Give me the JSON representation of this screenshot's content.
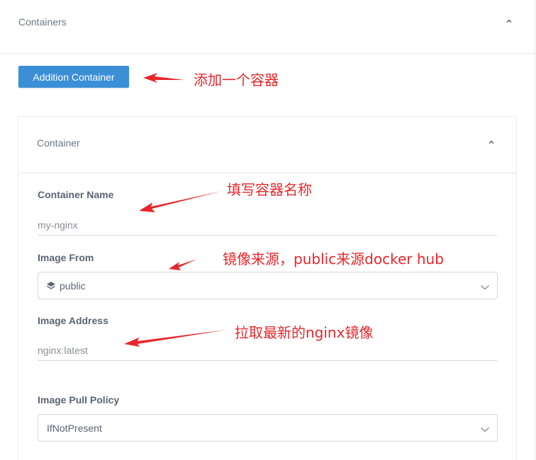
{
  "outer_panel": {
    "title": "Containers"
  },
  "add_button": {
    "label": "Addition Container"
  },
  "container_card": {
    "title": "Container",
    "fields": {
      "name": {
        "label": "Container Name",
        "value": "my-nginx"
      },
      "image_from": {
        "label": "Image From",
        "value": "public",
        "icon": "layers-icon"
      },
      "image_address": {
        "label": "Image Address",
        "value": "nginx:latest"
      },
      "pull_policy": {
        "label": "Image Pull Policy",
        "value": "IfNotPresent"
      }
    }
  },
  "annotations": {
    "add_note": "添加一个容器",
    "name_note": "填写容器名称",
    "from_note": "镜像来源，public来源docker hub",
    "address_note": "拉取最新的nginx镜像"
  },
  "colors": {
    "primary": "#3a8fd6",
    "annotation": "#e8262b"
  }
}
